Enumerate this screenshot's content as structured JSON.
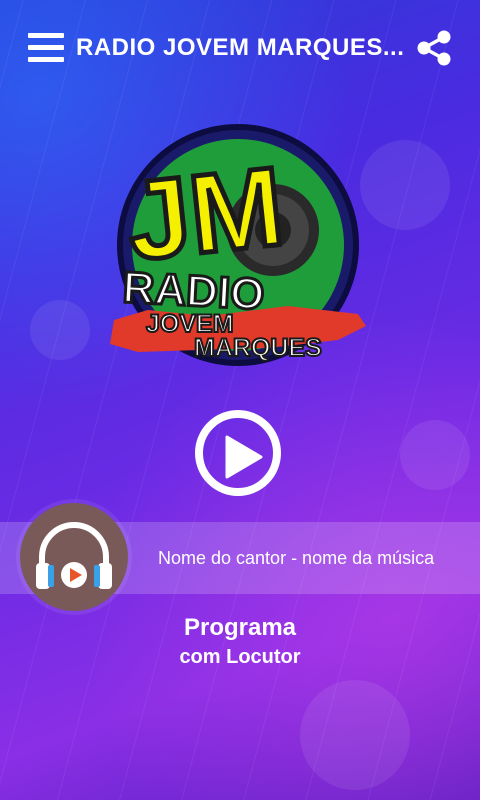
{
  "header": {
    "title": "RADIO JOVEM MARQUES...",
    "menu_icon": "hamburger-menu-icon",
    "share_icon": "share-icon"
  },
  "logo": {
    "top_text": "JM",
    "line1": "RADIO",
    "line2": "JOVEM",
    "line3": "MARQUES"
  },
  "player": {
    "play_icon": "play-icon",
    "track_info": "Nome do cantor - nome da música",
    "cover_icon": "headphones-play-icon"
  },
  "program": {
    "title": "Programa",
    "host": "com Locutor"
  },
  "colors": {
    "background_top": "#2b3bd8",
    "background_bottom": "#8a2fe6",
    "logo_yellow": "#f4f000",
    "logo_red": "#e23a2a",
    "logo_green": "#1f9d3a",
    "cover_bg": "#7a5a59"
  }
}
